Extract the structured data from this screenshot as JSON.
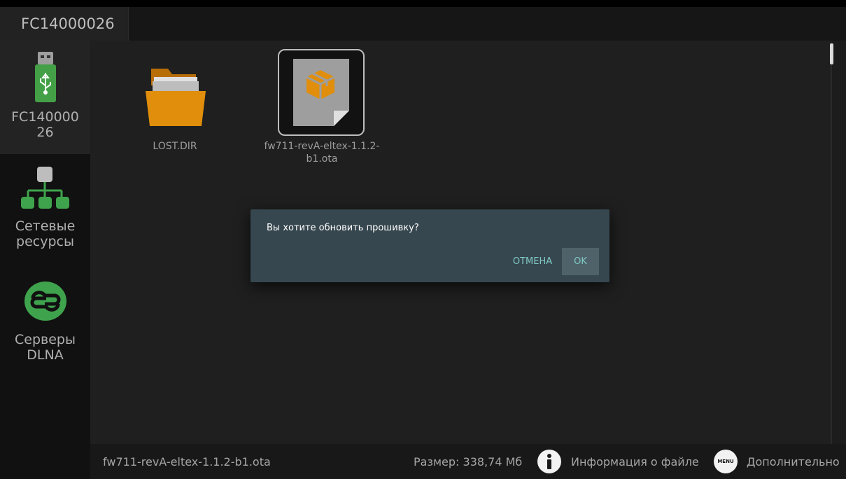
{
  "topbar": {
    "tab_title": "FC14000026"
  },
  "sidebar": {
    "items": [
      {
        "label": "FC140000\n26",
        "icon": "usb-drive-icon",
        "active": true
      },
      {
        "label": "Сетевые\nресурсы",
        "icon": "network-icon",
        "active": false
      },
      {
        "label": "Серверы\nDLNA",
        "icon": "dlna-icon",
        "active": false
      }
    ]
  },
  "files": [
    {
      "name": "LOST.DIR",
      "icon": "folder-icon"
    },
    {
      "name": "fw711-revA-eltex-1.1.2-\nb1.ota",
      "icon": "package-file-icon",
      "selected": true
    }
  ],
  "dialog": {
    "message": "Вы хотите обновить прошивку?",
    "cancel_label": "ОТМЕНА",
    "ok_label": "OK"
  },
  "bottombar": {
    "filename": "fw711-revA-eltex-1.1.2-b1.ota",
    "size": "Размер: 338,74 Мб",
    "info_label": "Информация о файле",
    "menu_badge": "MENU",
    "more_label": "Дополнительно"
  },
  "colors": {
    "accent_teal": "#80cbc4",
    "dialog_bg": "#37474f",
    "folder_orange": "#e08e0b",
    "network_green": "#3fa34d"
  }
}
